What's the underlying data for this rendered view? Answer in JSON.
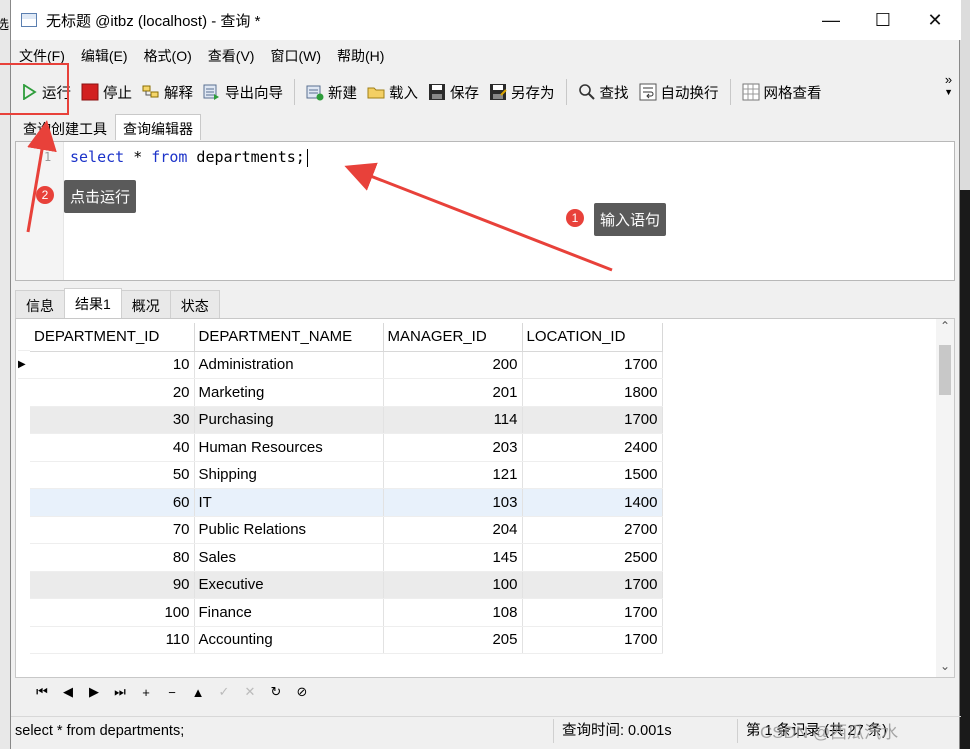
{
  "window": {
    "title": "无标题 @itbz (localhost) - 查询 *",
    "controls": [
      "—",
      "☐",
      "✕"
    ]
  },
  "left_strip_text": "选",
  "menu": [
    "文件(F)",
    "编辑(E)",
    "格式(O)",
    "查看(V)",
    "窗口(W)",
    "帮助(H)"
  ],
  "toolbar": {
    "run": "运行",
    "stop": "停止",
    "explain": "解释",
    "export_wizard": "导出向导",
    "new": "新建",
    "load": "载入",
    "save": "保存",
    "save_as": "另存为",
    "find": "查找",
    "word_wrap": "自动换行",
    "grid_view": "网格查看",
    "more": "»"
  },
  "subtabs": [
    "查询创建工具",
    "查询编辑器"
  ],
  "editor": {
    "line_number": "1",
    "code_kw1": "select",
    "code_mid": " * ",
    "code_kw2": "from",
    "code_rest": " departments;"
  },
  "annotations": {
    "step1_num": "1",
    "step1_text": "输入语句",
    "step2_num": "2",
    "step2_text": "点击运行",
    "arrow_color": "#e8413a"
  },
  "result_tabs": [
    "信息",
    "结果1",
    "概况",
    "状态"
  ],
  "grid": {
    "columns": [
      "DEPARTMENT_ID",
      "DEPARTMENT_NAME",
      "MANAGER_ID",
      "LOCATION_ID"
    ],
    "rows": [
      [
        "10",
        "Administration",
        "200",
        "1700"
      ],
      [
        "20",
        "Marketing",
        "201",
        "1800"
      ],
      [
        "30",
        "Purchasing",
        "114",
        "1700"
      ],
      [
        "40",
        "Human Resources",
        "203",
        "2400"
      ],
      [
        "50",
        "Shipping",
        "121",
        "1500"
      ],
      [
        "60",
        "IT",
        "103",
        "1400"
      ],
      [
        "70",
        "Public Relations",
        "204",
        "2700"
      ],
      [
        "80",
        "Sales",
        "145",
        "2500"
      ],
      [
        "90",
        "Executive",
        "100",
        "1700"
      ],
      [
        "100",
        "Finance",
        "108",
        "1700"
      ],
      [
        "110",
        "Accounting",
        "205",
        "1700"
      ]
    ]
  },
  "nav_buttons": [
    "⏮",
    "◀",
    "▶",
    "⏭",
    "+",
    "−",
    "▲",
    "✓",
    "✕",
    "↻",
    "⊘"
  ],
  "status": {
    "sql": "select * from departments;",
    "query_time": "查询时间: 0.001s",
    "record": "第 1 条记录 (共 27 条)"
  },
  "watermark": "CSDN @西瓜汽水"
}
